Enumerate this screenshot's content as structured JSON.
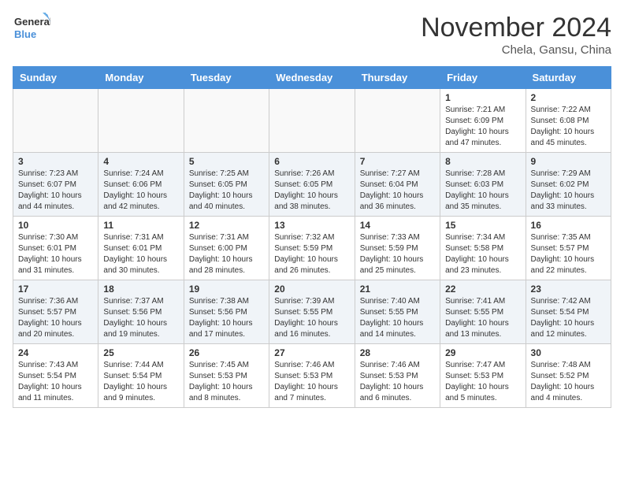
{
  "header": {
    "logo_line1": "General",
    "logo_line2": "Blue",
    "month_title": "November 2024",
    "location": "Chela, Gansu, China"
  },
  "weekdays": [
    "Sunday",
    "Monday",
    "Tuesday",
    "Wednesday",
    "Thursday",
    "Friday",
    "Saturday"
  ],
  "weeks": [
    [
      {
        "day": null
      },
      {
        "day": null
      },
      {
        "day": null
      },
      {
        "day": null
      },
      {
        "day": null
      },
      {
        "day": 1,
        "sunrise": "Sunrise: 7:21 AM",
        "sunset": "Sunset: 6:09 PM",
        "daylight": "Daylight: 10 hours and 47 minutes."
      },
      {
        "day": 2,
        "sunrise": "Sunrise: 7:22 AM",
        "sunset": "Sunset: 6:08 PM",
        "daylight": "Daylight: 10 hours and 45 minutes."
      }
    ],
    [
      {
        "day": 3,
        "sunrise": "Sunrise: 7:23 AM",
        "sunset": "Sunset: 6:07 PM",
        "daylight": "Daylight: 10 hours and 44 minutes."
      },
      {
        "day": 4,
        "sunrise": "Sunrise: 7:24 AM",
        "sunset": "Sunset: 6:06 PM",
        "daylight": "Daylight: 10 hours and 42 minutes."
      },
      {
        "day": 5,
        "sunrise": "Sunrise: 7:25 AM",
        "sunset": "Sunset: 6:05 PM",
        "daylight": "Daylight: 10 hours and 40 minutes."
      },
      {
        "day": 6,
        "sunrise": "Sunrise: 7:26 AM",
        "sunset": "Sunset: 6:05 PM",
        "daylight": "Daylight: 10 hours and 38 minutes."
      },
      {
        "day": 7,
        "sunrise": "Sunrise: 7:27 AM",
        "sunset": "Sunset: 6:04 PM",
        "daylight": "Daylight: 10 hours and 36 minutes."
      },
      {
        "day": 8,
        "sunrise": "Sunrise: 7:28 AM",
        "sunset": "Sunset: 6:03 PM",
        "daylight": "Daylight: 10 hours and 35 minutes."
      },
      {
        "day": 9,
        "sunrise": "Sunrise: 7:29 AM",
        "sunset": "Sunset: 6:02 PM",
        "daylight": "Daylight: 10 hours and 33 minutes."
      }
    ],
    [
      {
        "day": 10,
        "sunrise": "Sunrise: 7:30 AM",
        "sunset": "Sunset: 6:01 PM",
        "daylight": "Daylight: 10 hours and 31 minutes."
      },
      {
        "day": 11,
        "sunrise": "Sunrise: 7:31 AM",
        "sunset": "Sunset: 6:01 PM",
        "daylight": "Daylight: 10 hours and 30 minutes."
      },
      {
        "day": 12,
        "sunrise": "Sunrise: 7:31 AM",
        "sunset": "Sunset: 6:00 PM",
        "daylight": "Daylight: 10 hours and 28 minutes."
      },
      {
        "day": 13,
        "sunrise": "Sunrise: 7:32 AM",
        "sunset": "Sunset: 5:59 PM",
        "daylight": "Daylight: 10 hours and 26 minutes."
      },
      {
        "day": 14,
        "sunrise": "Sunrise: 7:33 AM",
        "sunset": "Sunset: 5:59 PM",
        "daylight": "Daylight: 10 hours and 25 minutes."
      },
      {
        "day": 15,
        "sunrise": "Sunrise: 7:34 AM",
        "sunset": "Sunset: 5:58 PM",
        "daylight": "Daylight: 10 hours and 23 minutes."
      },
      {
        "day": 16,
        "sunrise": "Sunrise: 7:35 AM",
        "sunset": "Sunset: 5:57 PM",
        "daylight": "Daylight: 10 hours and 22 minutes."
      }
    ],
    [
      {
        "day": 17,
        "sunrise": "Sunrise: 7:36 AM",
        "sunset": "Sunset: 5:57 PM",
        "daylight": "Daylight: 10 hours and 20 minutes."
      },
      {
        "day": 18,
        "sunrise": "Sunrise: 7:37 AM",
        "sunset": "Sunset: 5:56 PM",
        "daylight": "Daylight: 10 hours and 19 minutes."
      },
      {
        "day": 19,
        "sunrise": "Sunrise: 7:38 AM",
        "sunset": "Sunset: 5:56 PM",
        "daylight": "Daylight: 10 hours and 17 minutes."
      },
      {
        "day": 20,
        "sunrise": "Sunrise: 7:39 AM",
        "sunset": "Sunset: 5:55 PM",
        "daylight": "Daylight: 10 hours and 16 minutes."
      },
      {
        "day": 21,
        "sunrise": "Sunrise: 7:40 AM",
        "sunset": "Sunset: 5:55 PM",
        "daylight": "Daylight: 10 hours and 14 minutes."
      },
      {
        "day": 22,
        "sunrise": "Sunrise: 7:41 AM",
        "sunset": "Sunset: 5:55 PM",
        "daylight": "Daylight: 10 hours and 13 minutes."
      },
      {
        "day": 23,
        "sunrise": "Sunrise: 7:42 AM",
        "sunset": "Sunset: 5:54 PM",
        "daylight": "Daylight: 10 hours and 12 minutes."
      }
    ],
    [
      {
        "day": 24,
        "sunrise": "Sunrise: 7:43 AM",
        "sunset": "Sunset: 5:54 PM",
        "daylight": "Daylight: 10 hours and 11 minutes."
      },
      {
        "day": 25,
        "sunrise": "Sunrise: 7:44 AM",
        "sunset": "Sunset: 5:54 PM",
        "daylight": "Daylight: 10 hours and 9 minutes."
      },
      {
        "day": 26,
        "sunrise": "Sunrise: 7:45 AM",
        "sunset": "Sunset: 5:53 PM",
        "daylight": "Daylight: 10 hours and 8 minutes."
      },
      {
        "day": 27,
        "sunrise": "Sunrise: 7:46 AM",
        "sunset": "Sunset: 5:53 PM",
        "daylight": "Daylight: 10 hours and 7 minutes."
      },
      {
        "day": 28,
        "sunrise": "Sunrise: 7:46 AM",
        "sunset": "Sunset: 5:53 PM",
        "daylight": "Daylight: 10 hours and 6 minutes."
      },
      {
        "day": 29,
        "sunrise": "Sunrise: 7:47 AM",
        "sunset": "Sunset: 5:53 PM",
        "daylight": "Daylight: 10 hours and 5 minutes."
      },
      {
        "day": 30,
        "sunrise": "Sunrise: 7:48 AM",
        "sunset": "Sunset: 5:52 PM",
        "daylight": "Daylight: 10 hours and 4 minutes."
      }
    ]
  ]
}
